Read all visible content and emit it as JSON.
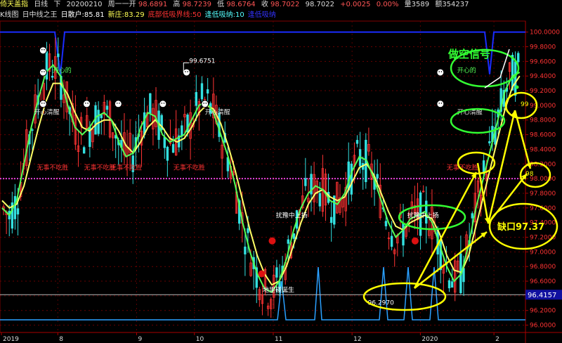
{
  "header": {
    "name": "倚天盖指",
    "period": "日线",
    "dir": "下",
    "date": "20200210",
    "weekday": "周一",
    "open_label": "开",
    "open": "98.6891",
    "high_label": "高",
    "high": "98.7239",
    "low_label": "低",
    "low": "98.6764",
    "close_label": "收",
    "close": "98.7022",
    "last": "98.7022",
    "change": "+0.0025",
    "change_pct": "0.00%",
    "vol_label": "量",
    "vol": "3589",
    "amount_label": "额",
    "amount": "354237"
  },
  "indicator_bar": {
    "items": [
      {
        "text": "K线图",
        "color": "#dddddd"
      },
      {
        "text": "日中线之王",
        "color": "#dddddd"
      },
      {
        "text": "日散户:85.81",
        "color": "#ffffff"
      },
      {
        "text": "新庄:83.29",
        "color": "#ffff55"
      },
      {
        "text": "底部低吸界线:50",
        "color": "#ff3333"
      },
      {
        "text": "逢低吸纳:10",
        "color": "#55ffff"
      },
      {
        "text": "逢低吸纳",
        "color": "#3333ff"
      }
    ]
  },
  "colors": {
    "up": "#ff3333",
    "down": "#33e0e0",
    "ma_fast": "#55ff55",
    "ma_slow": "#ffff66",
    "ref_line": "#dd44dd",
    "blue_line": "#1a2cff",
    "annot": "#ffff00",
    "green_annot": "#33ff33"
  },
  "chart_data": {
    "type": "candlestick",
    "ylim": [
      95.9,
      100.15
    ],
    "y_ticks": [
      "100.0000",
      "99.8000",
      "99.6000",
      "99.4000",
      "99.2000",
      "99.0000",
      "98.8000",
      "98.6000",
      "98.4000",
      "98.2000",
      "98.0000",
      "97.8000",
      "97.6000",
      "97.4000",
      "97.2000",
      "97.0000",
      "96.8000",
      "96.6000",
      "96.4000",
      "96.2000",
      "96.0000"
    ],
    "current_price_label": "96.4157",
    "current_price": 96.4157,
    "x_labels": [
      {
        "label": "2019",
        "t": 0.5
      },
      {
        "label": "8",
        "t": 0.11
      },
      {
        "label": "9",
        "t": 0.26
      },
      {
        "label": "10",
        "t": 0.37
      },
      {
        "label": "11",
        "t": 0.52
      },
      {
        "label": "12",
        "t": 0.67
      },
      {
        "label": "2020",
        "t": 0.8
      },
      {
        "label": "2",
        "t": 0.94
      }
    ],
    "ma_fast": [
      97.6,
      97.5,
      97.7,
      98.2,
      98.7,
      99.1,
      99.45,
      99.55,
      99.4,
      99.0,
      98.7,
      98.6,
      98.7,
      98.85,
      98.9,
      98.8,
      98.5,
      98.3,
      98.35,
      98.7,
      98.9,
      98.85,
      98.6,
      98.5,
      98.55,
      98.6,
      98.8,
      99.0,
      99.05,
      98.9,
      98.6,
      98.3,
      97.9,
      97.4,
      97.0,
      96.7,
      96.5,
      96.45,
      96.6,
      96.9,
      97.3,
      97.6,
      97.8,
      97.9,
      97.85,
      97.7,
      97.65,
      97.8,
      98.1,
      98.3,
      98.25,
      98.0,
      97.7,
      97.4,
      97.2,
      97.3,
      97.45,
      97.5,
      97.55,
      97.4,
      97.1,
      96.8,
      96.6,
      96.7,
      97.1,
      97.6,
      98.0,
      98.4,
      98.8,
      99.2,
      99.4,
      99.45
    ],
    "ma_slow": [
      97.7,
      97.6,
      97.65,
      97.9,
      98.3,
      98.7,
      99.05,
      99.3,
      99.3,
      99.15,
      98.9,
      98.7,
      98.65,
      98.75,
      98.8,
      98.8,
      98.65,
      98.45,
      98.35,
      98.5,
      98.7,
      98.8,
      98.7,
      98.55,
      98.5,
      98.55,
      98.7,
      98.9,
      99.0,
      98.95,
      98.75,
      98.45,
      98.1,
      97.7,
      97.3,
      96.95,
      96.7,
      96.55,
      96.6,
      96.8,
      97.1,
      97.4,
      97.65,
      97.8,
      97.85,
      97.75,
      97.7,
      97.75,
      97.95,
      98.15,
      98.2,
      98.05,
      97.8,
      97.55,
      97.35,
      97.3,
      97.4,
      97.45,
      97.5,
      97.45,
      97.25,
      96.95,
      96.75,
      96.72,
      96.95,
      97.35,
      97.75,
      98.15,
      98.55,
      98.95,
      99.25,
      99.4
    ],
    "ref_line": 98.0,
    "top_line": 100.0,
    "markers": [
      {
        "t": 0.082,
        "y": 99.75
      },
      {
        "t": 0.082,
        "y": 99.45
      },
      {
        "t": 0.082,
        "y": 99.02
      },
      {
        "t": 0.165,
        "y": 99.02
      },
      {
        "t": 0.225,
        "y": 99.02
      },
      {
        "t": 0.355,
        "y": 99.45
      },
      {
        "t": 0.31,
        "y": 99.02
      },
      {
        "t": 0.39,
        "y": 99.02
      },
      {
        "t": 0.838,
        "y": 99.45
      },
      {
        "t": 0.838,
        "y": 99.02
      }
    ],
    "red_dots": [
      {
        "t": 0.518,
        "y": 97.15
      },
      {
        "t": 0.79,
        "y": 97.15
      },
      {
        "t": 0.498,
        "y": 96.7
      }
    ],
    "labels": [
      {
        "text": "99.6751",
        "t": 0.36,
        "y": 99.58,
        "color": "#ffffff"
      },
      {
        "text": "开心清醒",
        "t": 0.065,
        "y": 98.88,
        "color": "#dddddd"
      },
      {
        "text": "开心清醒",
        "t": 0.39,
        "y": 98.88,
        "color": "#dddddd"
      },
      {
        "text": "开心清醒",
        "t": 0.87,
        "y": 98.88,
        "color": "#dddddd"
      },
      {
        "text": "无事不吃胜",
        "t": 0.07,
        "y": 98.12,
        "color": "#ff3333"
      },
      {
        "text": "无事不吃胜",
        "t": 0.16,
        "y": 98.12,
        "color": "#ff3333"
      },
      {
        "text": "无事不吃胜",
        "t": 0.21,
        "y": 98.12,
        "color": "#ff3333"
      },
      {
        "text": "无事不吃胜",
        "t": 0.33,
        "y": 98.12,
        "color": "#ff3333"
      },
      {
        "text": "无事不吃胜",
        "t": 0.85,
        "y": 98.12,
        "color": "#ff3333"
      },
      {
        "text": "扰豫中上扬",
        "t": 0.525,
        "y": 97.47,
        "color": "#ffffff"
      },
      {
        "text": "扰豫中上扬",
        "t": 0.775,
        "y": 97.47,
        "color": "#ffffff"
      },
      {
        "text": "地里碰诞生",
        "t": 0.5,
        "y": 96.45,
        "color": "#ffffff"
      },
      {
        "text": "96.2970",
        "t": 0.7,
        "y": 96.28,
        "color": "#ffffff"
      },
      {
        "text": "开心的",
        "t": 0.1,
        "y": 99.45,
        "color": "#55ff55"
      },
      {
        "text": "开心的",
        "t": 0.87,
        "y": 99.45,
        "color": "#55ff55"
      }
    ],
    "annotations": {
      "signal_title": "做空信号",
      "gap_label": "缺口97.37",
      "target_99": "99",
      "target_98": "98"
    }
  }
}
